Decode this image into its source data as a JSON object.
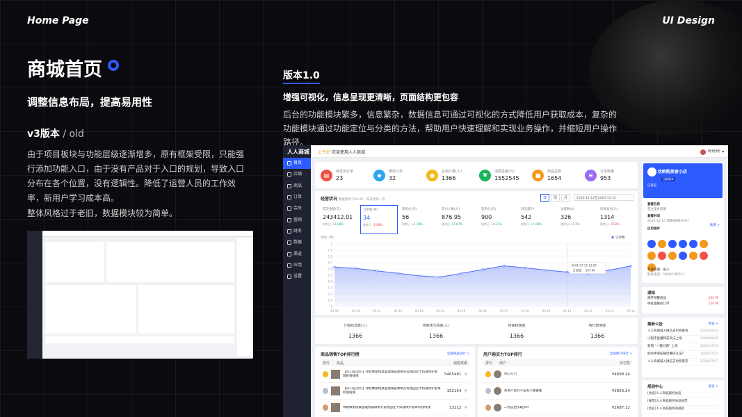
{
  "header": {
    "left": "Home Page",
    "right": "UI Design"
  },
  "left": {
    "title": "商城首页",
    "subtitle": "调整信息布局，提高易用性",
    "version": "v3版本",
    "version_sep": " / ",
    "version_old": "old",
    "paragraph1": "由于项目板块与功能层级逐渐增多，原有框架受限，只能强行添加功能入口，由于没有产品对于入口的规划，导致入口分布在各个位置，没有逻辑性。降低了运营人员的工作效率，新用户学习成本高。",
    "paragraph2": "整体风格过于老旧，数据模块较为简单。"
  },
  "right": {
    "version": "版本1.0",
    "headline": "增强可视化，信息呈现更清晰，页面结构更包容",
    "description": "后台的功能模块繁多，信息繁杂，数据信息可通过可视化的方式降低用户获取成本，复杂的功能模块通过功能定位与分类的方法，帮助用户快速理解和实现业务操作，并缩短用户操作路径。"
  },
  "dashboard": {
    "logo": "人人商城",
    "greeting_hi": "上午好",
    "greeting": "欢迎使用人人商城",
    "user": "叶叶叶",
    "sidebar": [
      "首页",
      "店铺",
      "商品",
      "订单",
      "会员",
      "营销",
      "财务",
      "数据",
      "渠道",
      "应用",
      "设置"
    ],
    "stats": [
      {
        "label": "待发货订单",
        "value": "23",
        "color": "#f0524a",
        "icon": "cart-icon"
      },
      {
        "label": "维权订单",
        "value": "32",
        "color": "#2fa5f0",
        "icon": "shield-icon"
      },
      {
        "label": "总用户数(人)",
        "value": "1366",
        "color": "#f5b81f",
        "icon": "user-icon"
      },
      {
        "label": "消费总额(元)",
        "value": "1552545",
        "color": "#19b35a",
        "icon": "yen-icon"
      },
      {
        "label": "商品总数",
        "value": "1654",
        "color": "#f39a1d",
        "icon": "box-icon"
      },
      {
        "label": "订单数量",
        "value": "953",
        "color": "#9b6cf0",
        "icon": "list-icon"
      }
    ],
    "ops": {
      "title": "经营状况",
      "note": "数据更新于00:00，每日更新一次",
      "tabs": [
        "日",
        "周",
        "月"
      ],
      "date_range": "2020-12-12至2020-12-12"
    },
    "kpis": [
      {
        "label": "成交金额(元)",
        "value": "243412.01",
        "change": "+1.08%",
        "dir": "up"
      },
      {
        "label": "订单数(件)",
        "value": "34",
        "change": "-1.08%",
        "dir": "dn"
      },
      {
        "label": "笔单价(元)",
        "value": "56",
        "change": "+1.08%",
        "dir": "up"
      },
      {
        "label": "支付人数(人)",
        "value": "876.95",
        "change": "+1.67%",
        "dir": "up"
      },
      {
        "label": "客单价(元)",
        "value": "900",
        "change": "+0.23%",
        "dir": "up"
      },
      {
        "label": "浏览量PV",
        "value": "542",
        "change": "+1.08%",
        "dir": "up"
      },
      {
        "label": "访客数UV",
        "value": "326",
        "change": "+1.2%",
        "dir": "up"
      },
      {
        "label": "新增会员(人)",
        "value": "1314",
        "change": "-0.02%",
        "dir": "dn"
      }
    ],
    "kpi_prefix": "较昨日",
    "chart_data": {
      "type": "area",
      "ylabel": "单位（件）",
      "legend": "订单数",
      "yticks": [
        "2",
        "1.9",
        "1.8",
        "1.7",
        "1.6",
        "1.5",
        "1.4",
        "1.3",
        "1.2",
        "1.1",
        "1"
      ],
      "x": [
        "03-09",
        "03-10",
        "03-11",
        "03-12",
        "03-13",
        "03-14",
        "03-15",
        "03-16",
        "03-17",
        "03-18",
        "03-19",
        "03-11",
        "03-12",
        "03-13",
        "03-14"
      ],
      "values": [
        1.63,
        1.61,
        1.57,
        1.53,
        1.49,
        1.47,
        1.53,
        1.59,
        1.65,
        1.62,
        1.58,
        1.55,
        1.53,
        1.58,
        1.65
      ],
      "ylim": [
        1,
        2
      ],
      "tooltip": {
        "date": "2041-07-12  13:00",
        "label": "订单数：",
        "value": "167.66"
      }
    },
    "summary": [
      {
        "label": "分销商总数(人)",
        "value": "1366"
      },
      {
        "label": "待审核分销商(人)",
        "value": "1366"
      },
      {
        "label": "待审核佣金",
        "value": "1366"
      },
      {
        "label": "待打款佣金",
        "value": "1366"
      }
    ],
    "top_products": {
      "title": "商品销售TOP排行榜",
      "link": "全部商品排行 >",
      "cols": [
        "排行",
        "商品",
        "销售数量"
      ],
      "rows": [
        {
          "name": "【双11狂欢价】绿联数据线桌面理线器收纳充电线固定卡扣器保护套耳机线线线",
          "qty": "5465481",
          "unit": "件"
        },
        {
          "name": "【双11狂欢价】绿联数据线桌面理线器收纳充电线固定卡扣器保护套耳机线线线",
          "qty": "152154",
          "unit": "件"
        },
        {
          "name": "绿联数据线桌面理线器收纳充电线固定卡扣器保护套耳机线线线",
          "qty": "13112",
          "unit": "件"
        }
      ]
    },
    "top_users": {
      "title": "用户购买力TOP排行",
      "link": "全部用户排行 >",
      "cols": [
        "排行",
        "用户",
        "实付款"
      ],
      "rows": [
        {
          "name": "地心引力",
          "amount": "¥4698.24"
        },
        {
          "name": "距离产生的不是美小曼雅雅",
          "amount": "¥3956.24"
        },
        {
          "name": "二营自由乐趣多⑩",
          "amount": "¥2687.12"
        }
      ]
    },
    "store": {
      "name": "优鲜购美食小店",
      "status": "店铺名",
      "badge": "当前版本",
      "account_label": "套餐名称",
      "account_value": "营业美食套餐",
      "expire_label": "套餐时间",
      "expire_value": "2020-12-14 到期(剩余30天)",
      "renew": "续费 >",
      "apps_title": "应用插件",
      "manager_label": "专属客服：",
      "manager_name": "张三",
      "manager_phone_label": "联系电话：",
      "manager_phone": "18562781111"
    },
    "notice": {
      "title": "通知",
      "items": [
        {
          "label": "库存预警商品",
          "value": "332 件"
        },
        {
          "label": "待处理维权订单",
          "value": "156 件"
        }
      ]
    },
    "announcements": {
      "title": "最新公告",
      "more": "更多 >",
      "items": [
        {
          "text": "人人商城域入微信支付商家券",
          "date": "2020/08/02"
        },
        {
          "text": "小程序直播和安玩法上线",
          "date": "2020/08/06"
        },
        {
          "text": "新増 “一键分佣” 上线",
          "date": "2020/07/23"
        },
        {
          "text": "如何申请压缩优惠码认证?",
          "date": "2020/07/07"
        },
        {
          "text": "人人商城域入微信支付商家券",
          "date": "2020/07/07"
        }
      ]
    },
    "rules": {
      "title": "规则中心",
      "more": "更多 >",
      "items": [
        "[协议]人人商城服务协议",
        "[规范]人人商城服务协议规范",
        "[协议]人人商城服务的规则"
      ]
    }
  }
}
